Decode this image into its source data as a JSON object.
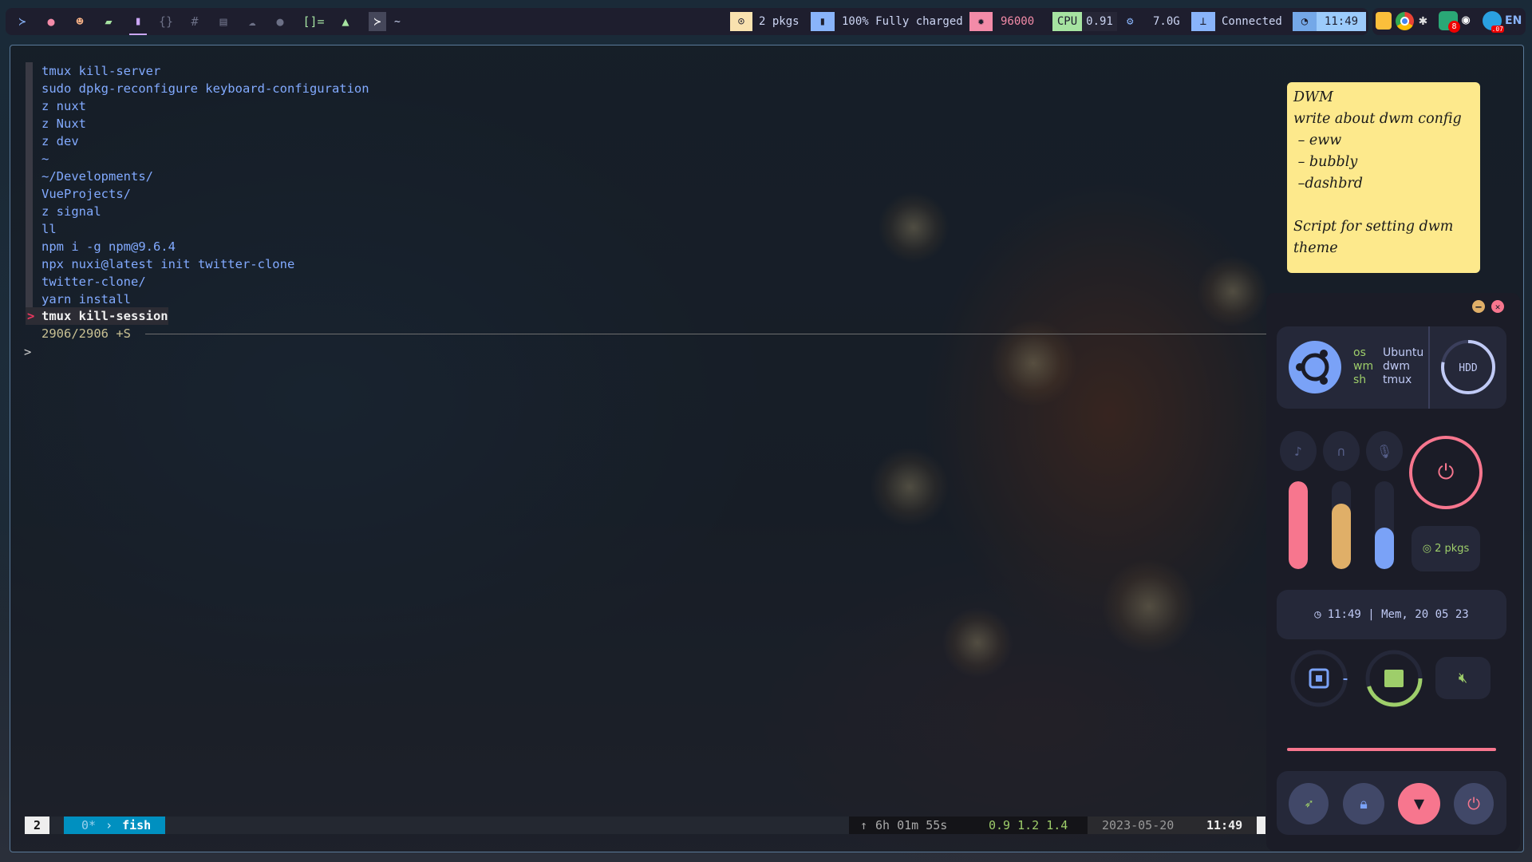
{
  "colors": {
    "accent_pink": "#f7768e",
    "accent_blue": "#7aa2f7",
    "accent_green": "#9ece6a",
    "accent_yellow": "#e0af68",
    "bar_bg": "#1e1e2e",
    "panel_bg": "#1b1c27"
  },
  "topbar": {
    "workspace_icons": [
      "terminal-icon",
      "firefox-icon",
      "face-icon",
      "folder-icon",
      "files-star-icon",
      "code-icon",
      "hash-icon",
      "archive-icon",
      "cloud-icon",
      "chat-icon",
      "layout-icon",
      "vim-icon",
      "active-terminal-icon"
    ],
    "layout_symbol": "[]=",
    "active_title": "~",
    "updates": {
      "icon": "update-icon",
      "text": "2 pkgs"
    },
    "battery": {
      "icon": "battery-icon",
      "text": "100% Fully charged"
    },
    "brightness": {
      "icon": "brightness-icon",
      "text": "96000"
    },
    "cpu": {
      "label": "CPU",
      "value": "0.91"
    },
    "memory": {
      "icon": "memory-icon",
      "value": "7.0G"
    },
    "network": {
      "icon": "wifi-icon",
      "text": "Connected"
    },
    "clock": {
      "icon": "clock-icon",
      "time": "11:49"
    },
    "tray": {
      "apps": [
        "notes-icon",
        "chrome-icon",
        "slack-icon",
        "signal-icon",
        "discord-icon",
        "telegram-icon"
      ],
      "signal_badge": "8",
      "telegram_badge": ".07",
      "lang": "EN"
    }
  },
  "terminal": {
    "history": [
      "tmux kill-server",
      "sudo dpkg-reconfigure keyboard-configuration",
      "z nuxt",
      "z Nuxt",
      "z dev",
      "~",
      "~/Developments/",
      "VueProjects/",
      "z signal",
      "ll",
      "npm i -g npm@9.6.4",
      "npx nuxi@latest init twitter-clone",
      "twitter-clone/",
      "yarn install"
    ],
    "selected_marker": ">",
    "selected": "tmux kill-session",
    "count": "2906/2906 +S",
    "prompt": ">"
  },
  "tmux": {
    "window_index": "2",
    "window_name": "0*",
    "pane_cmd": "fish",
    "uptime_arrow": "↑",
    "uptime": "6h 01m 55s",
    "load": "0.9 1.2 1.4",
    "date": "2023-05-20",
    "time": "11:49"
  },
  "sticky_note": {
    "text": "DWM\nwrite about dwm config\n – eww\n – bubbly\n –dashbrd\n\nScript for setting dwm\ntheme"
  },
  "dashboard": {
    "sysinfo": {
      "labels": [
        "os",
        "wm",
        "sh"
      ],
      "values": [
        "Ubuntu",
        "dwm",
        "tmux"
      ],
      "disk_label": "HDD",
      "disk_usage_percent": 78
    },
    "audio": {
      "music_volume_percent": 100,
      "headphone_volume_percent": 75,
      "mic_volume_percent": 47
    },
    "updates": "2 pkgs",
    "datetime": "11:49 | Mem, 20 05 23",
    "cpu_usage_percent": 1,
    "ram_usage_percent": 45,
    "brightness_percent": 100,
    "buttons": [
      "launcher",
      "lock",
      "wifi",
      "power"
    ]
  }
}
